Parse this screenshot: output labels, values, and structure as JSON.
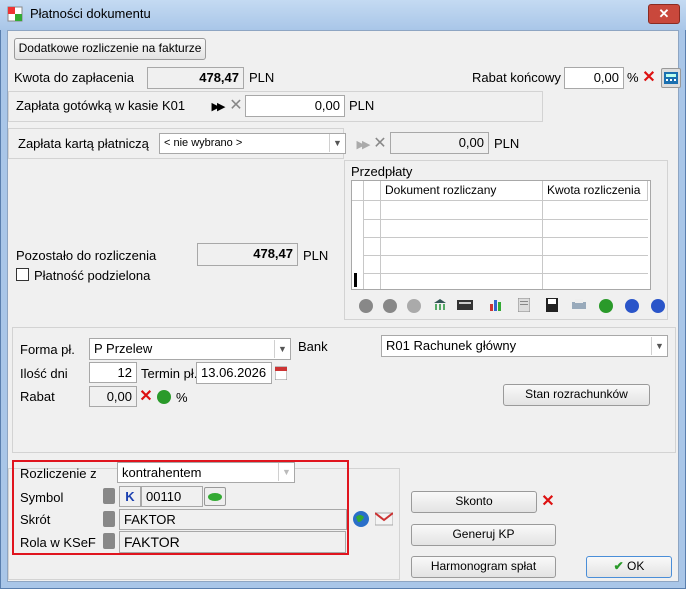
{
  "window": {
    "title": "Płatności dokumentu",
    "close": "✕"
  },
  "buttons": {
    "extra_settlement": "Dodatkowe rozliczenie na fakturze",
    "account_status": "Stan rozrachunków",
    "skonto": "Skonto",
    "generate_kp": "Generuj KP",
    "schedule": "Harmonogram spłat",
    "ok": "OK"
  },
  "amount": {
    "label": "Kwota do zapłacenia",
    "value": "478,47",
    "currency": "PLN"
  },
  "discount_final": {
    "label": "Rabat końcowy",
    "value": "0,00",
    "unit": "%"
  },
  "cash": {
    "label": "Zapłata gotówką w kasie K01",
    "value": "0,00",
    "currency": "PLN"
  },
  "card": {
    "label": "Zapłata kartą płatniczą",
    "selected": "< nie wybrano >",
    "value": "0,00",
    "currency": "PLN"
  },
  "prepayments": {
    "label": "Przedpłaty",
    "columns": [
      "Dokument rozliczany",
      "Kwota rozliczenia"
    ]
  },
  "remaining": {
    "label": "Pozostało do rozliczenia",
    "value": "478,47",
    "currency": "PLN"
  },
  "split_payment": {
    "label": "Płatność podzielona",
    "checked": false
  },
  "form": {
    "payment_form_label": "Forma pł.",
    "payment_form_value": "P  Przelew",
    "bank_label": "Bank",
    "bank_value": "R01 Rachunek główny",
    "days_label": "Ilość dni",
    "days_value": "12",
    "due_label": "Termin pł.",
    "due_value": "13.06.2026",
    "rebate_label": "Rabat",
    "rebate_value": "0,00",
    "rebate_unit": "%"
  },
  "settlement": {
    "with_label": "Rozliczenie z",
    "with_value": "kontrahentem",
    "symbol_label": "Symbol",
    "symbol_badge": "K",
    "symbol_value": "00110",
    "short_label": "Skrót",
    "short_value": "FAKTOR",
    "ksef_label": "Rola w KSeF",
    "ksef_value": "FAKTOR"
  },
  "colors": {
    "accent_red": "#e0141e",
    "title_bg": "#a9c6e8",
    "ok_check": "#2a9a2a"
  }
}
